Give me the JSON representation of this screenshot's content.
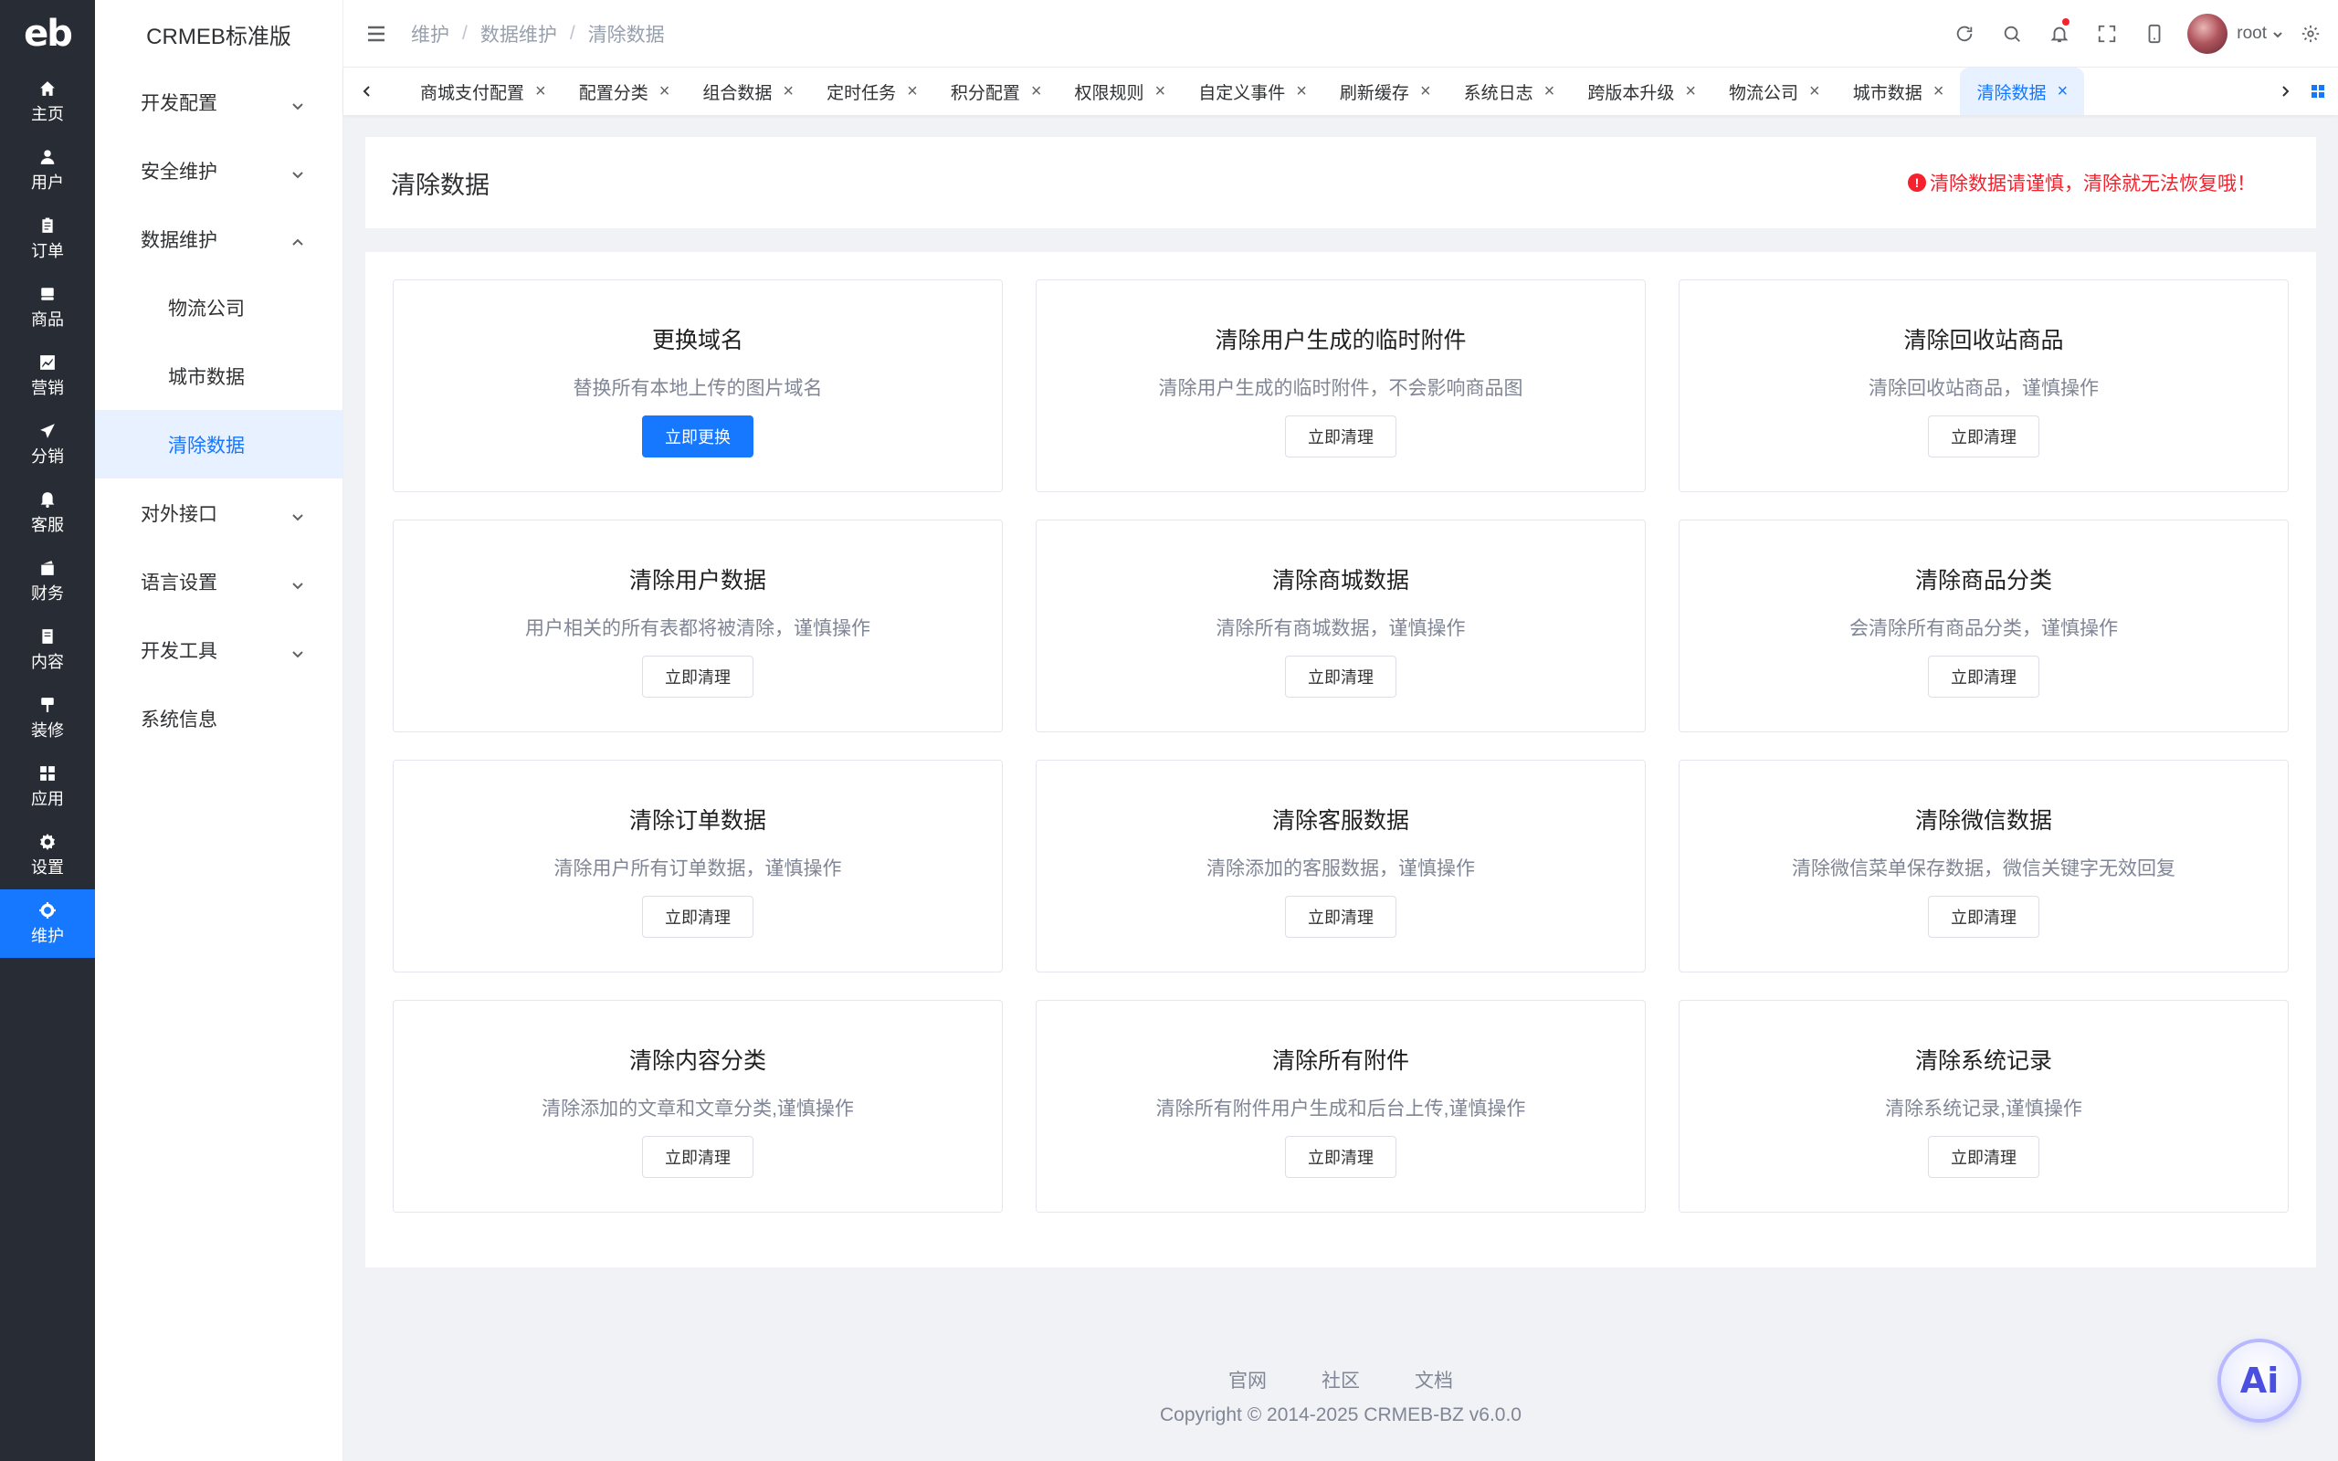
{
  "app": {
    "logo": "eb",
    "brand": "CRMEB标准版"
  },
  "rail": [
    {
      "label": "主页",
      "icon": "home-icon"
    },
    {
      "label": "用户",
      "icon": "user-icon"
    },
    {
      "label": "订单",
      "icon": "order-icon"
    },
    {
      "label": "商品",
      "icon": "product-icon"
    },
    {
      "label": "营销",
      "icon": "marketing-icon"
    },
    {
      "label": "分销",
      "icon": "distribution-icon"
    },
    {
      "label": "客服",
      "icon": "service-icon"
    },
    {
      "label": "财务",
      "icon": "finance-icon"
    },
    {
      "label": "内容",
      "icon": "content-icon"
    },
    {
      "label": "装修",
      "icon": "decoration-icon"
    },
    {
      "label": "应用",
      "icon": "apps-icon"
    },
    {
      "label": "设置",
      "icon": "settings-icon"
    },
    {
      "label": "维护",
      "icon": "maintenance-icon"
    }
  ],
  "submenu": {
    "dev_config": "开发配置",
    "security": "安全维护",
    "data_maintenance": "数据维护",
    "children": [
      "物流公司",
      "城市数据",
      "清除数据"
    ],
    "external_api": "对外接口",
    "language": "语言设置",
    "dev_tools": "开发工具",
    "system_info": "系统信息"
  },
  "breadcrumb": [
    "维护",
    "数据维护",
    "清除数据"
  ],
  "header": {
    "username": "root"
  },
  "tabs": [
    "商城支付配置",
    "配置分类",
    "组合数据",
    "定时任务",
    "积分配置",
    "权限规则",
    "自定义事件",
    "刷新缓存",
    "系统日志",
    "跨版本升级",
    "物流公司",
    "城市数据",
    "清除数据"
  ],
  "page": {
    "title": "清除数据",
    "warning": "清除数据请谨慎，清除就无法恢复哦！"
  },
  "cards": [
    {
      "title": "更换域名",
      "desc": "替换所有本地上传的图片域名",
      "button": "立即更换"
    },
    {
      "title": "清除用户生成的临时附件",
      "desc": "清除用户生成的临时附件，不会影响商品图",
      "button": "立即清理"
    },
    {
      "title": "清除回收站商品",
      "desc": "清除回收站商品，谨慎操作",
      "button": "立即清理"
    },
    {
      "title": "清除用户数据",
      "desc": "用户相关的所有表都将被清除，谨慎操作",
      "button": "立即清理"
    },
    {
      "title": "清除商城数据",
      "desc": "清除所有商城数据，谨慎操作",
      "button": "立即清理"
    },
    {
      "title": "清除商品分类",
      "desc": "会清除所有商品分类，谨慎操作",
      "button": "立即清理"
    },
    {
      "title": "清除订单数据",
      "desc": "清除用户所有订单数据，谨慎操作",
      "button": "立即清理"
    },
    {
      "title": "清除客服数据",
      "desc": "清除添加的客服数据，谨慎操作",
      "button": "立即清理"
    },
    {
      "title": "清除微信数据",
      "desc": "清除微信菜单保存数据，微信关键字无效回复",
      "button": "立即清理"
    },
    {
      "title": "清除内容分类",
      "desc": "清除添加的文章和文章分类,谨慎操作",
      "button": "立即清理"
    },
    {
      "title": "清除所有附件",
      "desc": "清除所有附件用户生成和后台上传,谨慎操作",
      "button": "立即清理"
    },
    {
      "title": "清除系统记录",
      "desc": "清除系统记录,谨慎操作",
      "button": "立即清理"
    }
  ],
  "footer": {
    "links": [
      "官网",
      "社区",
      "文档"
    ],
    "copyright": "Copyright © 2014-2025 CRMEB-BZ v6.0.0"
  },
  "ai_button": "Ai",
  "colors": {
    "primary": "#1677ff",
    "rail_bg": "#282c34",
    "danger": "#f5222d"
  }
}
